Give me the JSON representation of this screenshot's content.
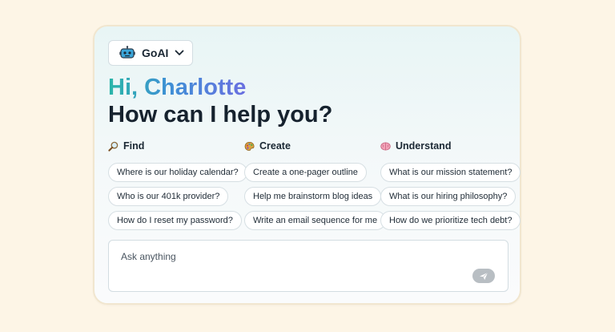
{
  "model_selector": {
    "label": "GoAI",
    "icon": "robot-icon"
  },
  "greeting": "Hi, Charlotte",
  "headline": "How can I help you?",
  "columns": [
    {
      "title": "Find",
      "icon": "magnifying-glass-icon",
      "chips": [
        "Where is our holiday calendar?",
        "Who is our 401k provider?",
        "How do I reset my password?"
      ]
    },
    {
      "title": "Create",
      "icon": "palette-icon",
      "chips": [
        "Create a one-pager outline",
        "Help me brainstorm blog ideas",
        "Write an email sequence for me"
      ]
    },
    {
      "title": "Understand",
      "icon": "brain-icon",
      "chips": [
        "What is our mission statement?",
        "What is our hiring philosophy?",
        "How do we prioritize tech debt?"
      ]
    }
  ],
  "ask": {
    "placeholder": "Ask anything",
    "value": ""
  },
  "colors": {
    "background": "#fdf5e6",
    "accent_start": "#2bb6a8",
    "accent_end": "#6a6fe0",
    "send_button": "#b8bec3"
  }
}
